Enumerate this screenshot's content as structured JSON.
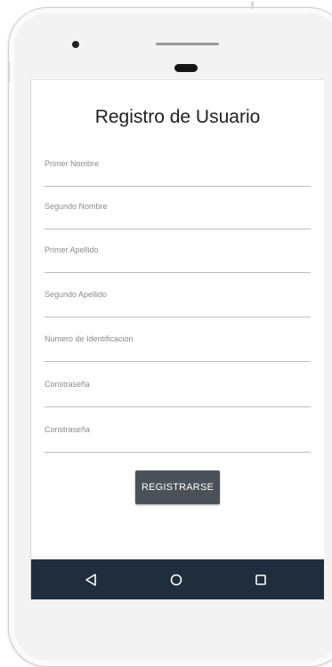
{
  "screen": {
    "title": "Registro de Usuario",
    "fields": [
      {
        "placeholder": "Primer Nombre",
        "value": ""
      },
      {
        "placeholder": "Segundo Nombre",
        "value": ""
      },
      {
        "placeholder": "Primer Apellido",
        "value": ""
      },
      {
        "placeholder": "Segundo Apellido",
        "value": ""
      },
      {
        "placeholder": "Numero de Identificacion",
        "value": ""
      },
      {
        "placeholder": "Constraseña",
        "value": ""
      },
      {
        "placeholder": "Constraseña",
        "value": ""
      }
    ],
    "submit_label": "REGISTRARSE"
  },
  "navbar": {
    "icons": [
      "back-triangle-icon",
      "home-circle-icon",
      "recents-square-icon"
    ],
    "background": "#1f2d3d"
  },
  "colors": {
    "button": "#4a5159",
    "title_text": "#202124"
  }
}
